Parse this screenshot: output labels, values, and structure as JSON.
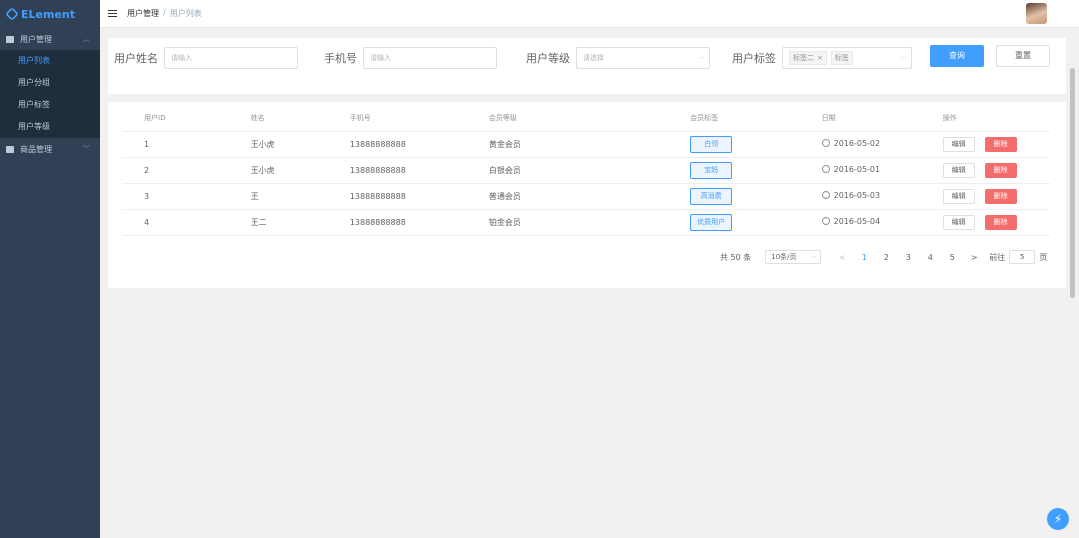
{
  "app": {
    "logo_text": "ELement"
  },
  "sidebar": {
    "groups": [
      {
        "label": "用户管理",
        "expanded": true
      },
      {
        "label": "商品管理",
        "expanded": false
      }
    ],
    "items": [
      {
        "label": "用户列表",
        "active": true
      },
      {
        "label": "用户分组",
        "active": false
      },
      {
        "label": "用户标签",
        "active": false
      },
      {
        "label": "用户等级",
        "active": false
      }
    ]
  },
  "header": {
    "breadcrumb": [
      "用户管理",
      "用户列表"
    ],
    "separator": "/"
  },
  "search": {
    "username_label": "用户姓名",
    "username_placeholder": "请输入",
    "phone_label": "手机号",
    "phone_placeholder": "请输入",
    "level_label": "用户等级",
    "level_placeholder": "请选择",
    "tag_label": "用户标签",
    "tags": [
      "标签二",
      "标签"
    ],
    "query_button": "查询",
    "reset_button": "重置"
  },
  "table": {
    "columns": [
      "用户ID",
      "姓名",
      "手机号",
      "会员等级",
      "会员标签",
      "日期",
      "操作"
    ],
    "rows": [
      {
        "id": "1",
        "name": "王小虎",
        "phone": "13888888888",
        "level": "黄金会员",
        "tag": "白领",
        "date": "2016-05-02"
      },
      {
        "id": "2",
        "name": "王小虎",
        "phone": "13888888888",
        "level": "白银会员",
        "tag": "宝妈",
        "date": "2016-05-01"
      },
      {
        "id": "3",
        "name": "王",
        "phone": "13888888888",
        "level": "普通会员",
        "tag": "高消费",
        "date": "2016-05-03"
      },
      {
        "id": "4",
        "name": "王二",
        "phone": "13888888888",
        "level": "铂金会员",
        "tag": "优质用户",
        "date": "2016-05-04"
      }
    ],
    "edit_label": "编辑",
    "delete_label": "删除"
  },
  "pagination": {
    "total_text": "共 50 条",
    "page_size_text": "10条/页",
    "prev": "<",
    "next": ">",
    "pages": [
      "1",
      "2",
      "3",
      "4",
      "5"
    ],
    "current_page": "1",
    "jump_label": "前往",
    "jump_value": "5",
    "page_unit": "页"
  },
  "colors": {
    "primary": "#409eff",
    "danger": "#f56c6c",
    "sidebar_bg": "#304156"
  },
  "icons": {
    "menu_toggle": "hamburger-icon",
    "group_icon": "folder-icon",
    "clock": "clock-icon",
    "fab": "lightning-icon"
  }
}
